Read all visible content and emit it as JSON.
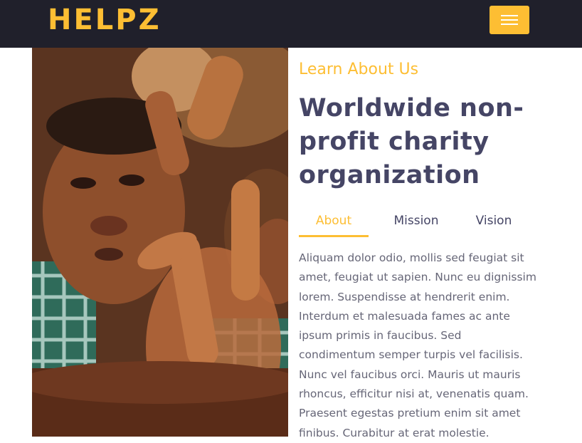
{
  "navbar": {
    "brand": "HELPZ",
    "toggler_color": "#fdbe33",
    "background": "#20202b"
  },
  "hero_image": {
    "icon": "photo-children-icon"
  },
  "about": {
    "subtitle": "Learn About Us",
    "headline": "Worldwide non-profit charity organization",
    "tabs": [
      {
        "label": "About",
        "active": true
      },
      {
        "label": "Mission",
        "active": false
      },
      {
        "label": "Vision",
        "active": false
      }
    ],
    "body": "Aliquam dolor odio, mollis sed feugiat sit amet, feugiat ut sapien. Nunc eu dignissim lorem. Suspendisse at hendrerit enim. Interdum et malesuada fames ac ante ipsum primis in faucibus. Sed condimentum semper turpis vel facilisis. Nunc vel faucibus orci. Mauris ut mauris rhoncus, efficitur nisi at, venenatis quam. Praesent egestas pretium enim sit amet finibus. Curabitur at erat molestie."
  },
  "colors": {
    "accent": "#fdbe33",
    "heading": "#454565",
    "text": "#666677"
  }
}
